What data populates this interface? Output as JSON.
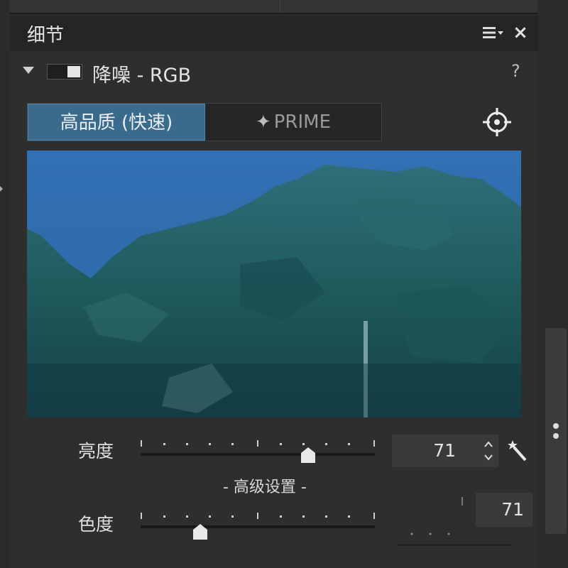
{
  "panel": {
    "title": "细节",
    "menu_icon": "hamburger-dropdown-icon",
    "close_icon": "close-icon",
    "close_glyph": "×"
  },
  "section": {
    "title": "降噪 - RGB",
    "help": "?",
    "enabled": true
  },
  "mode_tabs": [
    {
      "label": "高品质 (快速)",
      "active": true
    },
    {
      "label": "PRIME",
      "active": false
    }
  ],
  "preview": {
    "icon": "crosshair-icon"
  },
  "controls": {
    "brightness": {
      "label": "亮度",
      "value": "71"
    },
    "advanced_label": "- 高级设置 -",
    "chroma": {
      "label": "色度",
      "value": "71"
    }
  },
  "colors": {
    "accent": "#3a6a8c",
    "panel_bg": "#2e2e2e",
    "header_bg": "#252525"
  }
}
